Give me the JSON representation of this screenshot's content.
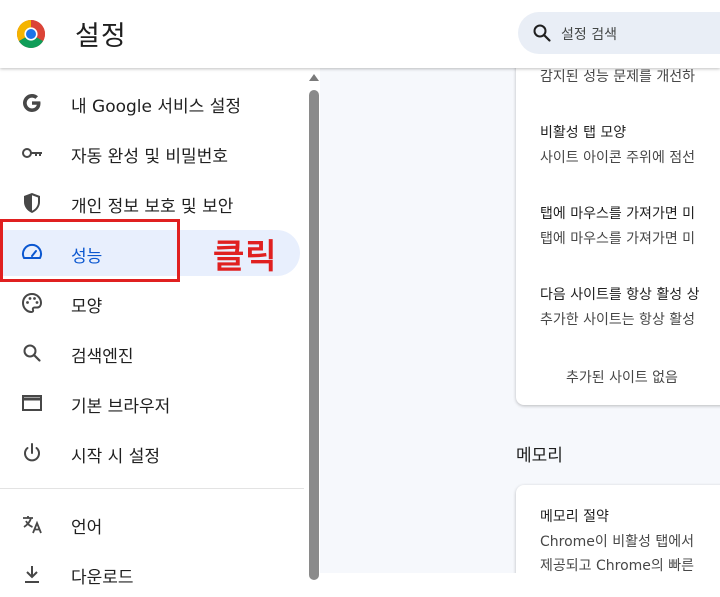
{
  "header": {
    "title": "설정",
    "search_placeholder": "설정 검색"
  },
  "sidebar": {
    "items": [
      {
        "label": "내 Google 서비스 설정",
        "icon": "google-icon"
      },
      {
        "label": "자동 완성 및 비밀번호",
        "icon": "key-icon"
      },
      {
        "label": "개인 정보 보호 및 보안",
        "icon": "shield-icon"
      },
      {
        "label": "성능",
        "icon": "speedometer-icon",
        "active": true
      },
      {
        "label": "모양",
        "icon": "palette-icon"
      },
      {
        "label": "검색엔진",
        "icon": "search-icon"
      },
      {
        "label": "기본 브라우저",
        "icon": "browser-window-icon"
      },
      {
        "label": "시작 시 설정",
        "icon": "power-icon"
      },
      {
        "label": "언어",
        "icon": "translate-icon"
      },
      {
        "label": "다운로드",
        "icon": "download-icon"
      }
    ]
  },
  "annotation": {
    "label": "클릭"
  },
  "main": {
    "performance_rows": [
      {
        "desc": "감지된 성능 문제를 개선하"
      },
      {
        "title": "비활성 탭 모양",
        "desc": "사이트 아이콘 주위에 점선"
      },
      {
        "title": "탭에 마우스를 가져가면 미",
        "desc": "탭에 마우스를 가져가면 미"
      },
      {
        "title": "다음 사이트를 항상 활성 상",
        "desc": "추가한 사이트는 항상 활성"
      }
    ],
    "no_sites": "추가된 사이트 없음",
    "memory_section": "메모리",
    "memory_card": {
      "title": "메모리 절약",
      "desc_line1": "Chrome이 비활성 탭에서",
      "desc_line2": "제공되고 Chrome의 빠른"
    }
  },
  "colors": {
    "accent": "#0b57d0",
    "active_bg": "#e8effd",
    "annotation_red": "#e02020",
    "search_bg": "#e9eef6",
    "main_bg": "#f6f8fc"
  }
}
